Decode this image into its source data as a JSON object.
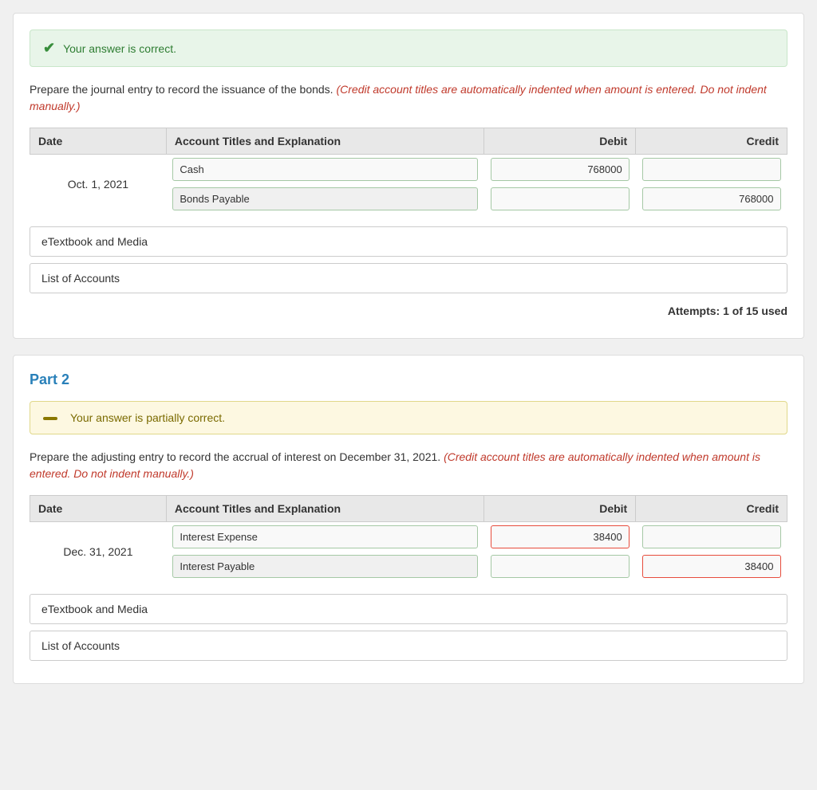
{
  "part1": {
    "alert": {
      "type": "success",
      "message": "Your answer is correct."
    },
    "instruction_plain": "Prepare the journal entry to record the issuance of the bonds.",
    "instruction_italic": "(Credit account titles are automatically indented when amount is entered. Do not indent manually.)",
    "table": {
      "headers": [
        "Date",
        "Account Titles and Explanation",
        "Debit",
        "Credit"
      ],
      "rows": [
        {
          "date": "Oct. 1, 2021",
          "entries": [
            {
              "account": "Cash",
              "debit": "768000",
              "credit": "",
              "debit_error": false,
              "credit_error": false,
              "indented": false
            },
            {
              "account": "Bonds Payable",
              "debit": "",
              "credit": "768000",
              "debit_error": false,
              "credit_error": false,
              "indented": true
            }
          ]
        }
      ]
    },
    "etextbook_label": "eTextbook and Media",
    "list_of_accounts_label": "List of Accounts",
    "attempts_label": "Attempts: 1 of 15 used"
  },
  "part2": {
    "title": "Part 2",
    "alert": {
      "type": "partial",
      "message": "Your answer is partially correct."
    },
    "instruction_plain": "Prepare the adjusting entry to record the accrual of interest on December 31, 2021.",
    "instruction_italic": "(Credit account titles are automatically indented when amount is entered. Do not indent manually.)",
    "table": {
      "headers": [
        "Date",
        "Account Titles and Explanation",
        "Debit",
        "Credit"
      ],
      "rows": [
        {
          "date": "Dec. 31, 2021",
          "entries": [
            {
              "account": "Interest Expense",
              "debit": "38400",
              "credit": "",
              "debit_error": true,
              "credit_error": false,
              "indented": false
            },
            {
              "account": "Interest Payable",
              "debit": "",
              "credit": "38400",
              "debit_error": false,
              "credit_error": true,
              "indented": true
            }
          ]
        }
      ]
    },
    "etextbook_label": "eTextbook and Media",
    "list_of_accounts_label": "List of Accounts"
  }
}
